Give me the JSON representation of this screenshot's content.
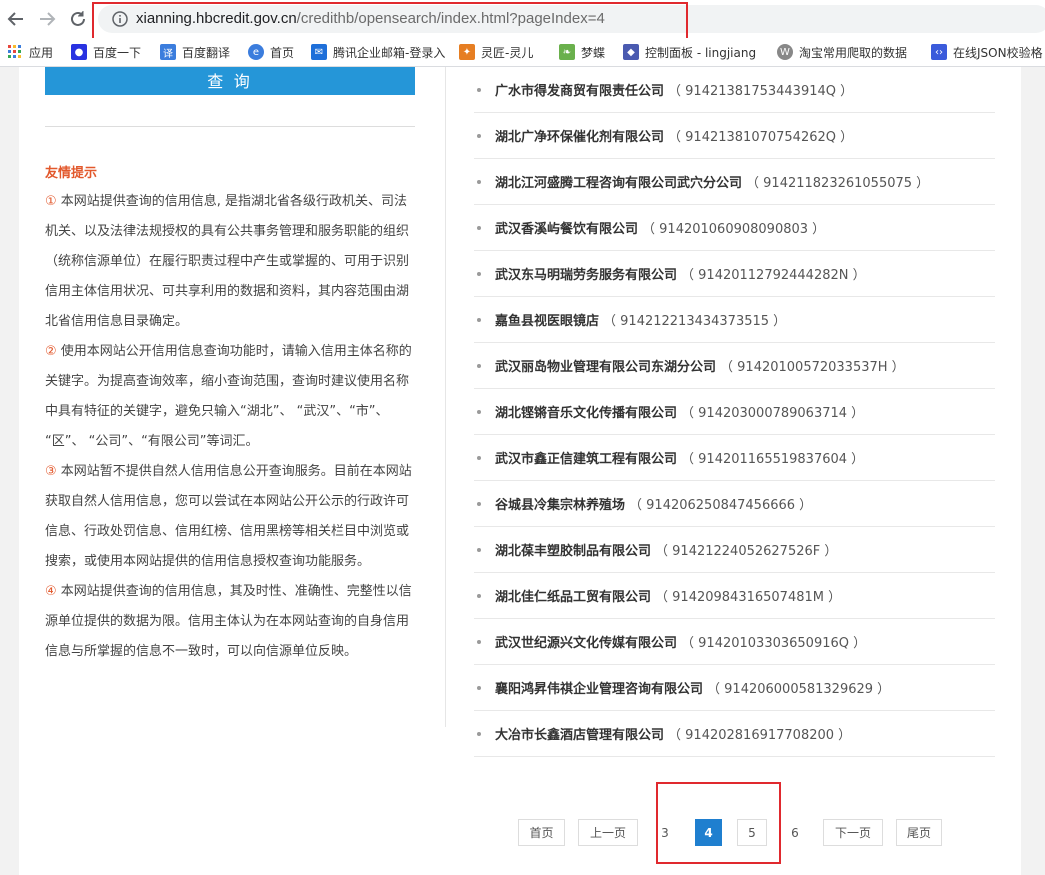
{
  "browser": {
    "url_domain": "xianning.hbcredit.gov.cn",
    "url_path": "/credithb/opensearch/index.html?pageIndex=4",
    "bookmarks": [
      {
        "label": "应用",
        "icon": "apps-grid-icon",
        "color": "#e8453c"
      },
      {
        "label": "百度一下",
        "icon": "baidu-paw-icon",
        "color": "#2932e1"
      },
      {
        "label": "百度翻译",
        "icon": "translate-icon",
        "color": "#3b7ddd"
      },
      {
        "label": "首页",
        "icon": "globe-icon",
        "color": "#3b7ddd"
      },
      {
        "label": "腾讯企业邮箱-登录入",
        "icon": "mail-icon",
        "color": "#1e6fd9"
      },
      {
        "label": "灵匠-灵儿",
        "icon": "bird-icon",
        "color": "#e67e22"
      },
      {
        "label": "梦蝶",
        "icon": "leaf-icon",
        "color": "#6ab04c"
      },
      {
        "label": "控制面板 - lingjiang",
        "icon": "panel-icon",
        "color": "#4a5ab0"
      },
      {
        "label": "淘宝常用爬取的数据",
        "icon": "wordpress-icon",
        "color": "#888888"
      },
      {
        "label": "在线JSON校验格",
        "icon": "code-icon",
        "color": "#3b5bdb"
      }
    ]
  },
  "search": {
    "button_label": "查 询"
  },
  "tips": {
    "title": "友情提示",
    "items": [
      {
        "num": "①",
        "text": " 本网站提供查询的信用信息, 是指湖北省各级行政机关、司法机关、以及法律法规授权的具有公共事务管理和服务职能的组织（统称信源单位）在履行职责过程中产生或掌握的、可用于识别信用主体信用状况、可共享利用的数据和资料，其内容范围由湖北省信用信息目录确定。"
      },
      {
        "num": "②",
        "text": " 使用本网站公开信用信息查询功能时，请输入信用主体名称的关键字。为提高查询效率，缩小查询范围，查询时建议使用名称中具有特征的关键字，避免只输入“湖北”、 “武汉”、“市”、 “区”、 “公司”、“有限公司”等词汇。"
      },
      {
        "num": "③",
        "text": " 本网站暂不提供自然人信用信息公开查询服务。目前在本网站获取自然人信用信息，您可以尝试在本网站公开公示的行政许可信息、行政处罚信息、信用红榜、信用黑榜等相关栏目中浏览或搜索，或使用本网站提供的信用信息授权查询功能服务。"
      },
      {
        "num": "④",
        "text": " 本网站提供查询的信用信息，其及时性、准确性、完整性以信源单位提供的数据为限。信用主体认为在本网站查询的自身信用信息与所掌握的信息不一致时，可以向信源单位反映。"
      }
    ]
  },
  "companies": [
    {
      "name": "广水市得发商贸有限责任公司",
      "code": "（ 91421381753443914Q ）"
    },
    {
      "name": "湖北广净环保催化剂有限公司",
      "code": "（ 91421381070754262Q ）"
    },
    {
      "name": "湖北江河盛腾工程咨询有限公司武穴分公司",
      "code": "（ 914211823261055075 ）"
    },
    {
      "name": "武汉香溪屿餐饮有限公司",
      "code": "（ 914201060908090803 ）"
    },
    {
      "name": "武汉东马明瑞劳务服务有限公司",
      "code": "（ 91420112792444282N ）"
    },
    {
      "name": "嘉鱼县视医眼镜店",
      "code": "（ 914212213434373515 ）"
    },
    {
      "name": "武汉丽岛物业管理有限公司东湖分公司",
      "code": "（ 91420100572033537H ）"
    },
    {
      "name": "湖北铿锵音乐文化传播有限公司",
      "code": "（ 914203000789063714 ）"
    },
    {
      "name": "武汉市鑫正信建筑工程有限公司",
      "code": "（ 914201165519837604 ）"
    },
    {
      "name": "谷城县冷集宗林养殖场",
      "code": "（ 914206250847456666 ）"
    },
    {
      "name": "湖北葆丰塑胶制品有限公司",
      "code": "（ 91421224052627526F ）"
    },
    {
      "name": "湖北佳仁纸品工贸有限公司",
      "code": "（ 91420984316507481M ）"
    },
    {
      "name": "武汉世纪源兴文化传媒有限公司",
      "code": "（ 91420103303650916Q ）"
    },
    {
      "name": "襄阳鸿昇伟祺企业管理咨询有限公司",
      "code": "（ 914206000581329629 ）"
    },
    {
      "name": "大冶市长鑫酒店管理有限公司",
      "code": "（ 914202816917708200 ）"
    }
  ],
  "pagination": {
    "first": "首页",
    "prev": "上一页",
    "pages": [
      "3",
      "4",
      "5",
      "6"
    ],
    "current": "4",
    "next": "下一页",
    "last": "尾页"
  },
  "colors": {
    "accent_blue": "#2596d8",
    "current_page": "#1f7fcf",
    "tip_orange": "#e2582c",
    "highlight_red": "#e0292e"
  }
}
